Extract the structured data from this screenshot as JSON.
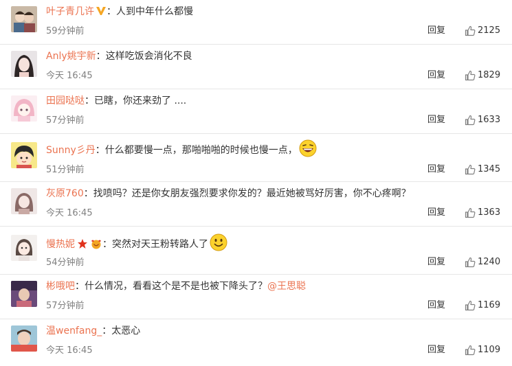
{
  "actions": {
    "reply_label": "回复"
  },
  "comments": [
    {
      "user": "叶子青几许",
      "text": "人到中年什么都慢",
      "time": "59分钟前",
      "likes": "2125"
    },
    {
      "user": "Anly姚宇新",
      "text": "这样吃饭会消化不良",
      "time": "今天 16:45",
      "likes": "1829"
    },
    {
      "user": "田园哒哒",
      "text": "已瞎，你还来劲了 ....",
      "time": "57分钟前",
      "likes": "1633"
    },
    {
      "user": "Sunny彡丹",
      "text": "什么都要慢一点，那啪啪啪的时候也慢一点，",
      "time": "51分钟前",
      "likes": "1345"
    },
    {
      "user": "灰原760",
      "text": "找喷吗？还是你女朋友强烈要求你发的？最近她被骂好厉害，你不心疼啊？",
      "time": "今天 16:45",
      "likes": "1363"
    },
    {
      "user": "慢热妮",
      "text": "突然对天王粉转路人了",
      "time": "54分钟前",
      "likes": "1240"
    },
    {
      "user": "彬哦吧",
      "text": "什么情况，看看这个是不是也被下降头了？",
      "mention": "@王思聪",
      "time": "57分钟前",
      "likes": "1169"
    },
    {
      "user": "温wenfang_",
      "text": "太恶心",
      "time": "今天 16:45",
      "likes": "1109"
    }
  ],
  "colon": "：",
  "colors": {
    "username": "#eb7350",
    "time": "#808080",
    "divider": "#e6e6e6"
  },
  "icons": {
    "verified": "verified-v-icon",
    "like": "thumbs-up-icon",
    "laugh": "laughing-emoji-icon",
    "smile": "smile-emoji-icon",
    "star": "star-badge-icon",
    "fan": "fan-badge-icon"
  }
}
